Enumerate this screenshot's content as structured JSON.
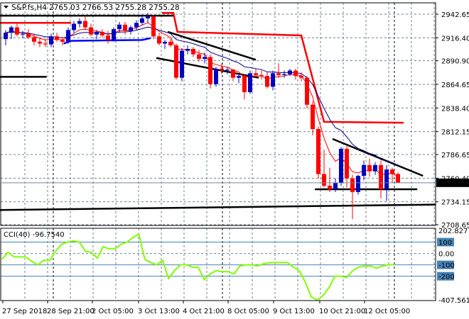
{
  "window": {
    "symbol_title": "S&P.fs,H4",
    "ohlc_readout": "2765.03 2766.53 2755.28 2755.28"
  },
  "colors": {
    "bull": "#0000c0",
    "bear": "#ff0000",
    "fast_ma": "#ff0000",
    "slow_ma": "#000080",
    "cci": "#80ff00",
    "level": "#4682b4",
    "grid": "#708090",
    "price_tag_bg": "#000000"
  },
  "chart_data": [
    {
      "type": "candlestick",
      "title": "S&P.fs,H4",
      "ylim": [
        2708.65,
        2942.65
      ],
      "y_ticks": [
        "2942.65",
        "2916.40",
        "2890.90",
        "2864.65",
        "2838.40",
        "2812.15",
        "2786.65",
        "2760.40",
        "2734.15",
        "2708.65"
      ],
      "current_price": "2755.28",
      "x_ticks": [
        "27 Sep 2018",
        "28 Sep 21:00",
        "2 Oct 05:00",
        "3 Oct 13:00",
        "4 Oct 21:00",
        "8 Oct 05:00",
        "9 Oct 13:00",
        "10 Oct 21:00",
        "12 Oct 05:00"
      ],
      "candles": [
        [
          2915,
          2925,
          2908,
          2922
        ],
        [
          2922,
          2930,
          2915,
          2928
        ],
        [
          2928,
          2932,
          2918,
          2920
        ],
        [
          2920,
          2924,
          2916,
          2921
        ],
        [
          2921,
          2926,
          2915,
          2917
        ],
        [
          2917,
          2921,
          2908,
          2912
        ],
        [
          2912,
          2916,
          2906,
          2910
        ],
        [
          2910,
          2915,
          2906,
          2909
        ],
        [
          2909,
          2921,
          2906,
          2918
        ],
        [
          2918,
          2922,
          2912,
          2914
        ],
        [
          2914,
          2917,
          2908,
          2912
        ],
        [
          2912,
          2928,
          2910,
          2925
        ],
        [
          2925,
          2935,
          2922,
          2932
        ],
        [
          2932,
          2938,
          2928,
          2935
        ],
        [
          2935,
          2940,
          2925,
          2928
        ],
        [
          2928,
          2932,
          2918,
          2920
        ],
        [
          2920,
          2925,
          2915,
          2923
        ],
        [
          2923,
          2926,
          2917,
          2919
        ],
        [
          2919,
          2924,
          2910,
          2914
        ],
        [
          2914,
          2928,
          2912,
          2926
        ],
        [
          2926,
          2934,
          2922,
          2931
        ],
        [
          2931,
          2934,
          2920,
          2924
        ],
        [
          2924,
          2930,
          2920,
          2928
        ],
        [
          2928,
          2936,
          2925,
          2933
        ],
        [
          2933,
          2942,
          2930,
          2938
        ],
        [
          2938,
          2944,
          2933,
          2940
        ],
        [
          2940,
          2942,
          2915,
          2918
        ],
        [
          2918,
          2922,
          2908,
          2910
        ],
        [
          2910,
          2914,
          2904,
          2912
        ],
        [
          2912,
          2915,
          2906,
          2908
        ],
        [
          2908,
          2910,
          2870,
          2872
        ],
        [
          2872,
          2905,
          2868,
          2902
        ],
        [
          2902,
          2908,
          2898,
          2904
        ],
        [
          2904,
          2906,
          2895,
          2898
        ],
        [
          2898,
          2903,
          2890,
          2893
        ],
        [
          2893,
          2900,
          2888,
          2895
        ],
        [
          2895,
          2898,
          2860,
          2865
        ],
        [
          2865,
          2884,
          2862,
          2882
        ],
        [
          2882,
          2888,
          2876,
          2880
        ],
        [
          2880,
          2884,
          2876,
          2881
        ],
        [
          2881,
          2882,
          2868,
          2872
        ],
        [
          2872,
          2876,
          2866,
          2874
        ],
        [
          2874,
          2876,
          2848,
          2856
        ],
        [
          2856,
          2880,
          2854,
          2877
        ],
        [
          2877,
          2882,
          2872,
          2875
        ],
        [
          2875,
          2880,
          2870,
          2874
        ],
        [
          2874,
          2878,
          2860,
          2862
        ],
        [
          2862,
          2880,
          2858,
          2877
        ],
        [
          2877,
          2888,
          2872,
          2875
        ],
        [
          2875,
          2880,
          2872,
          2876
        ],
        [
          2876,
          2882,
          2874,
          2880
        ],
        [
          2880,
          2882,
          2870,
          2874
        ],
        [
          2874,
          2878,
          2868,
          2872
        ],
        [
          2872,
          2874,
          2838,
          2842
        ],
        [
          2842,
          2846,
          2808,
          2815
        ],
        [
          2815,
          2818,
          2760,
          2765
        ],
        [
          2765,
          2792,
          2750,
          2752
        ],
        [
          2752,
          2772,
          2745,
          2748
        ],
        [
          2748,
          2760,
          2745,
          2755
        ],
        [
          2755,
          2795,
          2752,
          2793
        ],
        [
          2793,
          2796,
          2750,
          2760
        ],
        [
          2760,
          2764,
          2715,
          2745
        ],
        [
          2745,
          2764,
          2742,
          2763
        ],
        [
          2763,
          2780,
          2758,
          2775
        ],
        [
          2775,
          2782,
          2762,
          2768
        ],
        [
          2768,
          2778,
          2764,
          2775
        ],
        [
          2775,
          2780,
          2738,
          2748
        ],
        [
          2748,
          2775,
          2735,
          2770
        ],
        [
          2770,
          2772,
          2755,
          2765
        ],
        [
          2765.03,
          2766.53,
          2755.28,
          2755.28
        ]
      ],
      "trend_lines": [
        {
          "name": "upper-channel-line",
          "color": "#000000",
          "points": [
            [
              28.5,
              2923
            ],
            [
              44,
              2892
            ]
          ]
        },
        {
          "name": "lower-channel-line",
          "color": "#000000",
          "points": [
            [
              26.5,
              2894
            ],
            [
              44.5,
              2872
            ]
          ]
        },
        {
          "name": "triangle-upper-line",
          "color": "#000000",
          "points": [
            [
              57.5,
              2804
            ],
            [
              73.4,
              2763
            ]
          ]
        },
        {
          "name": "triangle-lower-line",
          "color": "#000000",
          "points": [
            [
              54.4,
              2748
            ],
            [
              72.4,
              2748
            ]
          ]
        },
        {
          "name": "long-support-line",
          "color": "#000000",
          "points": [
            [
              -1,
              2725
            ],
            [
              75.6,
              2731
            ]
          ]
        },
        {
          "name": "old-low-line",
          "color": "#000000",
          "points": [
            [
              -1,
              2873
            ],
            [
              7.2,
              2873
            ]
          ]
        },
        {
          "name": "old-high-line",
          "color": "#000000",
          "points": [
            [
              -1,
              2941
            ],
            [
              29.5,
              2941
            ]
          ]
        },
        {
          "name": "red-level-left",
          "color": "#ff0000",
          "points": [
            [
              -1,
              2933
            ],
            [
              11.5,
              2933
            ]
          ]
        },
        {
          "name": "red-step-line",
          "color": "#ff0000",
          "points": [
            [
              27.5,
              2944
            ],
            [
              29.5,
              2944
            ],
            [
              30.2,
              2923
            ],
            [
              52,
              2919
            ],
            [
              56,
              2823
            ],
            [
              70,
              2822
            ]
          ]
        },
        {
          "name": "blue-step-line",
          "color": "#0000ff",
          "points": [
            [
              10.2,
              2910
            ],
            [
              11.5,
              2913
            ],
            [
              24,
              2914
            ],
            [
              25.5,
              2916
            ]
          ]
        }
      ]
    },
    {
      "type": "line",
      "title": "CCI(40)",
      "current_value": "-96.7540",
      "ylim": [
        -407.5615,
        202.8277
      ],
      "y_ticks": [
        "202.8277",
        "100",
        "0.00",
        "-100",
        "-200",
        "-407.5615"
      ],
      "levels": [
        100,
        -100,
        -200
      ],
      "values": [
        -50,
        10,
        -30,
        -30,
        -30,
        -70,
        -100,
        -60,
        -60,
        20,
        80,
        100,
        110,
        100,
        20,
        10,
        -40,
        60,
        40,
        40,
        80,
        100,
        140,
        170,
        -50,
        -80,
        -100,
        -60,
        -220,
        -150,
        -100,
        -100,
        -120,
        -120,
        -230,
        -180,
        -150,
        -160,
        -160,
        -180,
        -110,
        -100,
        -100,
        -110,
        -90,
        -80,
        -80,
        -80,
        -80,
        -120,
        -150,
        -250,
        -380,
        -410,
        -370,
        -300,
        -200,
        -200,
        -210,
        -150,
        -120,
        -110,
        -110,
        -130,
        -110,
        -100,
        -97
      ]
    }
  ]
}
